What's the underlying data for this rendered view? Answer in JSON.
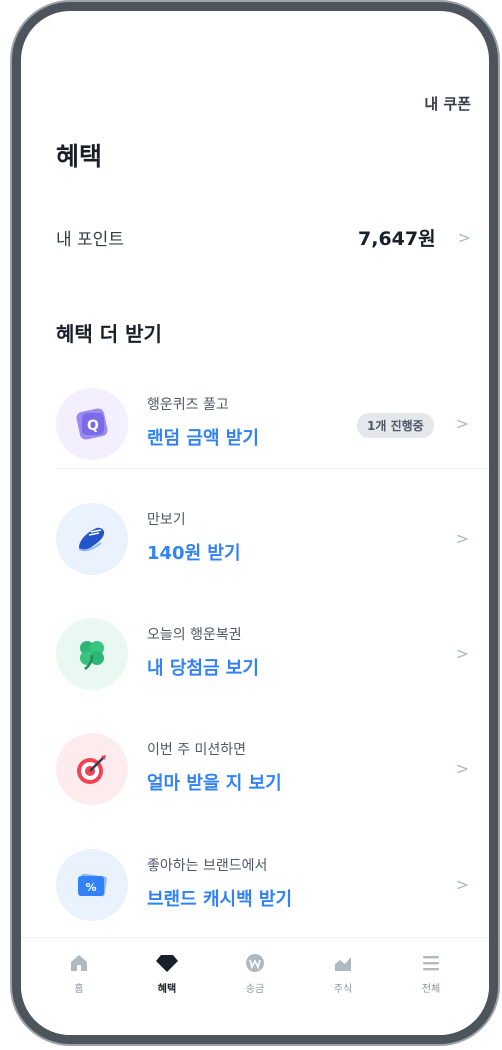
{
  "header": {
    "coupon_link": "내 쿠폰",
    "title": "혜택"
  },
  "points": {
    "label": "내 포인트",
    "value": "7,647원"
  },
  "section": {
    "title": "혜택 더 받기"
  },
  "items": [
    {
      "sub": "행운퀴즈 풀고",
      "main": "랜덤 금액 받기",
      "badge": "1개 진행중",
      "icon": "quiz-q-icon",
      "icon_bg": "#f3efff"
    },
    {
      "sub": "만보기",
      "main": "140원 받기",
      "icon": "shoe-icon",
      "icon_bg": "#eaf2fe"
    },
    {
      "sub": "오늘의 행운복권",
      "main": "내 당첨금 보기",
      "icon": "clover-icon",
      "icon_bg": "#eaf8f2"
    },
    {
      "sub": "이번 주 미션하면",
      "main": "얼마 받을 지 보기",
      "icon": "target-icon",
      "icon_bg": "#fdecee"
    },
    {
      "sub": "좋아하는 브랜드에서",
      "main": "브랜드 캐시백 받기",
      "icon": "percent-card-icon",
      "icon_bg": "#eaf2fe"
    }
  ],
  "tabs": [
    {
      "label": "홈",
      "icon": "home-icon"
    },
    {
      "label": "혜택",
      "icon": "diamond-icon",
      "active": true
    },
    {
      "label": "송금",
      "icon": "won-coin-icon"
    },
    {
      "label": "주식",
      "icon": "chart-icon"
    },
    {
      "label": "전체",
      "icon": "menu-icon"
    }
  ],
  "colors": {
    "accent": "#3182f6",
    "text": "#191f28",
    "muted": "#8b95a1",
    "frame": "#4d545c"
  }
}
